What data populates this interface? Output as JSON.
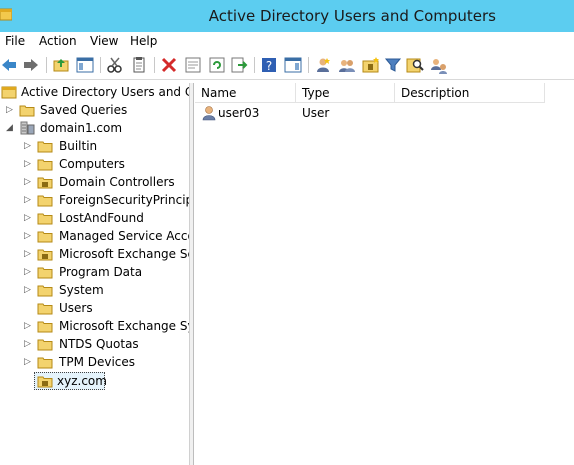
{
  "window": {
    "title": "Active Directory Users and Computers"
  },
  "menu": {
    "file": "File",
    "action": "Action",
    "view": "View",
    "help": "Help"
  },
  "tree": {
    "root_label": "Active Directory Users and Com",
    "saved_queries": "Saved Queries",
    "domain": "domain1.com",
    "children": [
      "Builtin",
      "Computers",
      "Domain Controllers",
      "ForeignSecurityPrincipals",
      "LostAndFound",
      "Managed Service Accour",
      "Microsoft Exchange Secu",
      "Program Data",
      "System",
      "Users",
      "Microsoft Exchange Syste",
      "NTDS Quotas",
      "TPM Devices",
      "xyz.com"
    ]
  },
  "list": {
    "columns": {
      "name": "Name",
      "type": "Type",
      "description": "Description"
    },
    "rows": [
      {
        "name": "user03",
        "type": "User",
        "description": ""
      }
    ]
  },
  "colors": {
    "titlebar": "#5ccdf0",
    "folder": "#f3d36e",
    "selection": "#e5f3fb"
  }
}
